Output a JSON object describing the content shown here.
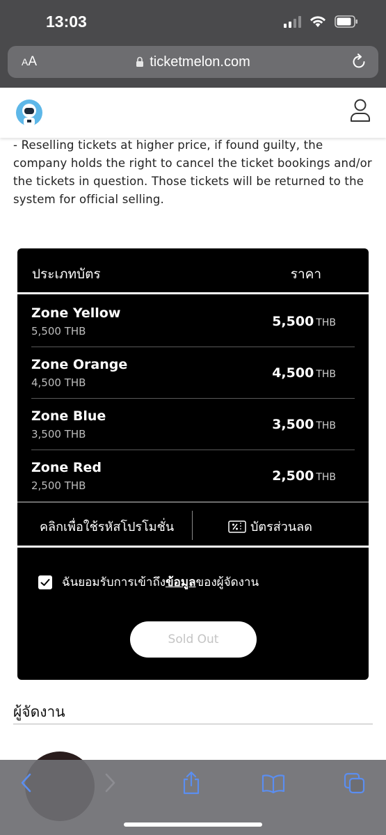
{
  "status_bar": {
    "time": "13:03"
  },
  "browser": {
    "aa_label_small": "A",
    "aa_label_large": "A",
    "url": "ticketmelon.com"
  },
  "terms_text": "- Reselling tickets at higher price, if found guilty, the company holds the right to cancel the ticket bookings and/or the tickets in question. Those tickets will be returned to the system for official selling.",
  "ticket_table": {
    "header_type": "ประเภทบัตร",
    "header_price": "ราคา",
    "zones": [
      {
        "name": "Zone Yellow",
        "sub": "5,500 THB",
        "price": "5,500",
        "currency": "THB"
      },
      {
        "name": "Zone Orange",
        "sub": "4,500 THB",
        "price": "4,500",
        "currency": "THB"
      },
      {
        "name": "Zone Blue",
        "sub": "3,500 THB",
        "price": "3,500",
        "currency": "THB"
      },
      {
        "name": "Zone Red",
        "sub": "2,500 THB",
        "price": "2,500",
        "currency": "THB"
      }
    ],
    "promo_code_label": "คลิกเพื่อใช้รหัสโปรโมชั่น",
    "discount_label": "บัตรส่วนลด",
    "consent_before": "ฉันยอมรับการเข้าถึง",
    "consent_link": "ข้อมูล",
    "consent_after": "ของผู้จัดงาน",
    "consent_checked": true,
    "sold_out_label": "Sold Out"
  },
  "organizer_heading": "ผู้จัดงาน",
  "colors": {
    "browser_chrome": "#4a4a4c",
    "url_bar": "#6d6d70",
    "ticket_box": "#000000",
    "toolbar_icon": "#5b8ef0"
  },
  "icons": {
    "toolbar": [
      "back-icon",
      "forward-icon",
      "share-icon",
      "bookmarks-icon",
      "tabs-icon"
    ]
  }
}
